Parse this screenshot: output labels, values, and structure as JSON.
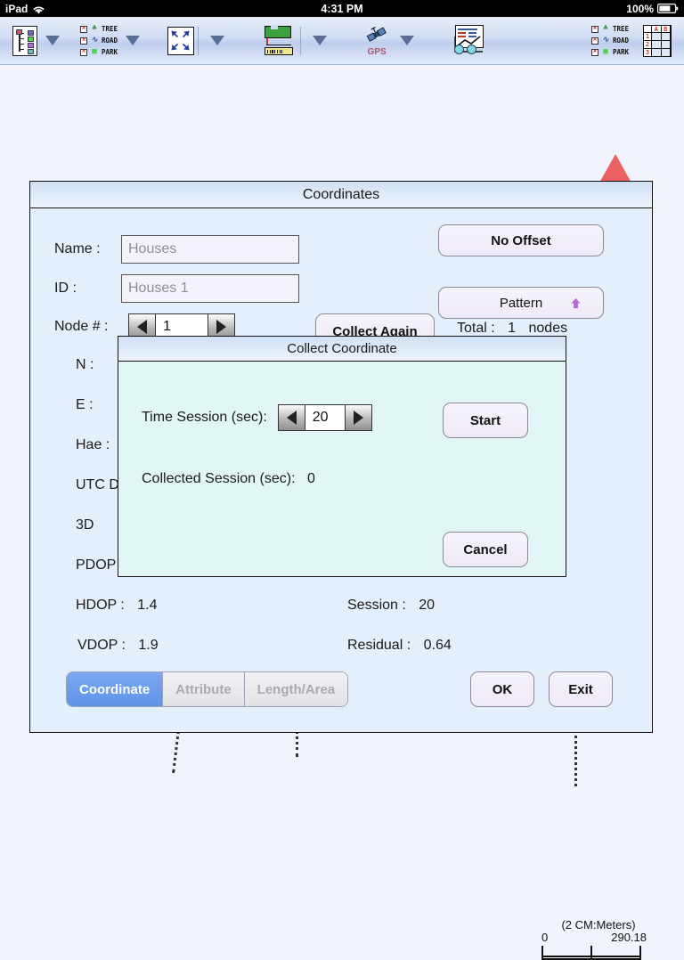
{
  "status_bar": {
    "device": "iPad",
    "wifi_icon": "wifi-icon",
    "time": "4:31 PM",
    "battery_percent": "100%",
    "battery_icon": "battery-icon"
  },
  "toolbar": {
    "items": [
      {
        "name": "layer-list-button",
        "icon": "layers-list-icon",
        "has_caret": true
      },
      {
        "name": "layer-visibility-button",
        "icon": "layer-legend-icon",
        "has_caret": true
      },
      {
        "name": "zoom-extents-button",
        "icon": "zoom-extents-icon",
        "has_caret": true
      },
      {
        "name": "measure-button",
        "icon": "measure-ruler-icon",
        "has_caret": true
      },
      {
        "name": "gps-button",
        "icon": "gps-satellite-icon",
        "has_caret": true
      },
      {
        "name": "graph-button",
        "icon": "graph-cart-icon",
        "has_caret": false
      },
      {
        "name": "legend-panel-button",
        "icon": "layer-legend-icon",
        "has_caret": false
      },
      {
        "name": "spreadsheet-button",
        "icon": "spreadsheet-icon",
        "has_caret": false
      }
    ],
    "legend_layers": [
      {
        "label": "TREE",
        "symbol": "♣",
        "color": "#3a9a4a"
      },
      {
        "label": "ROAD",
        "symbol": "∿",
        "color": "#3a5a9a"
      },
      {
        "label": "PARK",
        "symbol": "■",
        "color": "#4fd24f"
      }
    ],
    "gps_label": "GPS",
    "sheet_cols": [
      "A",
      "B"
    ],
    "sheet_rows": [
      "1",
      "2",
      "3"
    ]
  },
  "map": {
    "north_arrow_icon": "north-arrow-icon",
    "north_color_top": "#ec5f62",
    "north_color_bottom": "#4a4a55",
    "background_color": "#f2f4fd"
  },
  "scale_bar": {
    "caption": "(2 CM:Meters)",
    "min_label": "0",
    "max_label": "290.18"
  },
  "coordinates_dialog": {
    "title": "Coordinates",
    "name_label": "Name :",
    "name_value": "Houses",
    "name_placeholder": "Houses",
    "id_label": "ID :",
    "id_value": "Houses 1",
    "id_placeholder": "Houses 1",
    "node_label": "Node # :",
    "node_value": "1",
    "prev_node_icon": "triangle-left-icon",
    "next_node_icon": "triangle-right-icon",
    "collect_again_label": "Collect Again",
    "total_label": "Total :",
    "total_value": "1",
    "total_units": "nodes",
    "no_offset_label": "No Offset",
    "pattern_label": "Pattern",
    "pattern_icon": "up-arrow-icon",
    "pattern_icon_color": "#b06fd8",
    "fields": [
      {
        "label": "N :",
        "value": ""
      },
      {
        "label": "E :",
        "value": ""
      },
      {
        "label": "Hae :",
        "value": ""
      },
      {
        "label": "UTC D",
        "value": ""
      },
      {
        "label": "3D",
        "value": ""
      },
      {
        "label": "PDOP",
        "value": ""
      }
    ],
    "hdop_label": "HDOP :",
    "hdop_value": "1.4",
    "vdop_label": "VDOP :",
    "vdop_value": "1.9",
    "session_label": "Session :",
    "session_value": "20",
    "residual_label": "Residual :",
    "residual_value": "0.64",
    "tabs": [
      {
        "label": "Coordinate",
        "active": true
      },
      {
        "label": "Attribute",
        "active": false
      },
      {
        "label": "Length/Area",
        "active": false
      }
    ],
    "ok_label": "OK",
    "exit_label": "Exit"
  },
  "collect_modal": {
    "title": "Collect Coordinate",
    "time_session_label": "Time Session (sec):",
    "time_session_value": "20",
    "decrement_icon": "triangle-left-icon",
    "increment_icon": "triangle-right-icon",
    "start_label": "Start",
    "collected_session_label": "Collected Session (sec):",
    "collected_session_value": "0",
    "cancel_label": "Cancel"
  }
}
